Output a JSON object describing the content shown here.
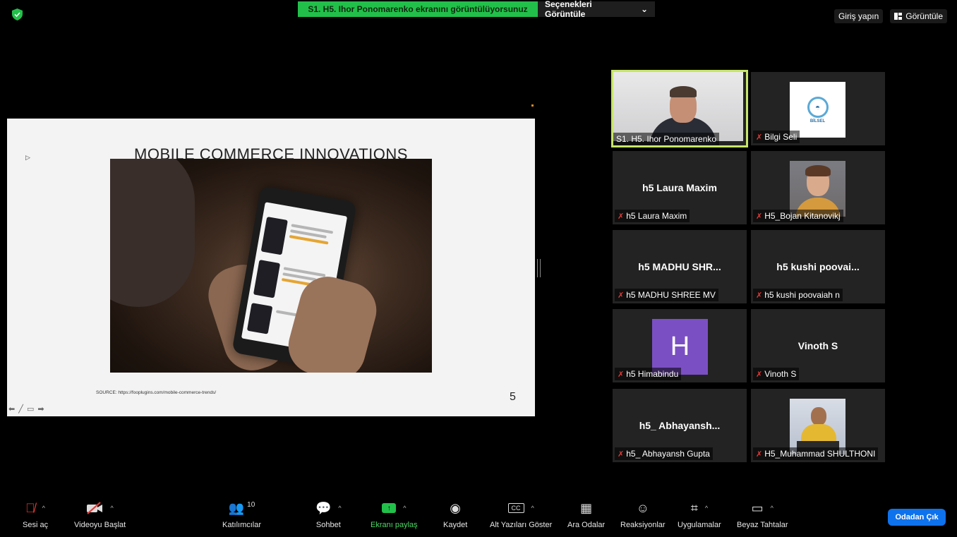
{
  "banner": {
    "sharing_text": "S1. H5. Ihor Ponomarenko ekranını görüntülüyorsunuz",
    "options_label": "Seçenekleri Görüntüle",
    "options_caret": "⌄"
  },
  "top_right": {
    "signin": "Giriş yapın",
    "view_label": "Görüntüle"
  },
  "slide": {
    "title": "MOBILE COMMERCE INNOVATIONS",
    "source": "SOURCE: https://fooplugins.com/mobile-commerce-trends/",
    "page_number": "5",
    "nav": "⬅ ╱ ▭ ➡"
  },
  "participants": [
    {
      "tag": "S1. H5. Ihor Ponomarenko",
      "big": "",
      "muted": false
    },
    {
      "tag": "Bilgi Seli",
      "big": "",
      "muted": true
    },
    {
      "tag": "h5 Laura Maxim",
      "big": "h5 Laura Maxim",
      "muted": true
    },
    {
      "tag": "H5_Bojan Kitanovikj",
      "big": "",
      "muted": true
    },
    {
      "tag": "h5 MADHU SHREE MV",
      "big": "h5 MADHU SHR...",
      "muted": true
    },
    {
      "tag": "h5 kushi poovaiah n",
      "big": "h5 kushi poovai...",
      "muted": true
    },
    {
      "tag": "h5 Himabindu",
      "big": "",
      "muted": true,
      "initial": "H"
    },
    {
      "tag": "Vinoth S",
      "big": "Vinoth S",
      "muted": true
    },
    {
      "tag": "h5_ Abhayansh Gupta",
      "big": "h5_ Abhayansh...",
      "muted": true
    },
    {
      "tag": "H5_Muhammad SHULTHONI",
      "big": "",
      "muted": true
    }
  ],
  "logo_text": "BİLSEL",
  "toolbar": {
    "audio": "Sesi aç",
    "video": "Videoyu Başlat",
    "participants": "Katılımcılar",
    "participants_count": "10",
    "chat": "Sohbet",
    "share": "Ekranı paylaş",
    "record": "Kaydet",
    "captions": "Alt Yazıları Göster",
    "captions_icon": "CC",
    "breakout": "Ara Odalar",
    "reactions": "Reaksiyonlar",
    "apps": "Uygulamalar",
    "whiteboard": "Beyaz Tahtalar",
    "leave": "Odadan Çık"
  },
  "colors": {
    "share_green": "#22c04a",
    "active_speaker": "#c7e56a",
    "leave_blue": "#0e72ed",
    "mic_off_red": "#e53935",
    "avatar_purple": "#7b4fc4"
  }
}
